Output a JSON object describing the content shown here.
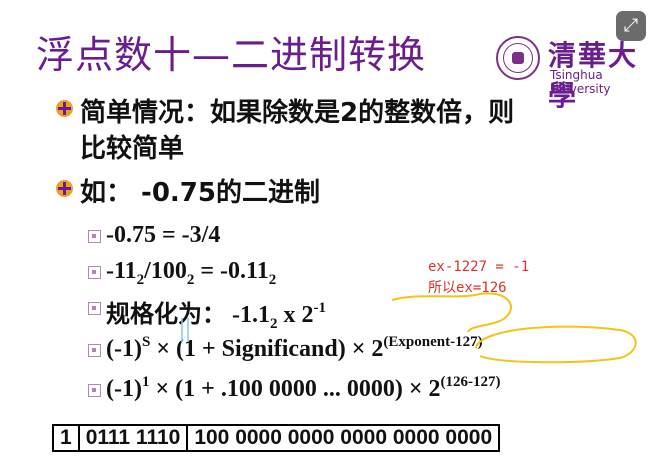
{
  "title": "浮点数十—二进制转换",
  "logo": {
    "chinese": "清華大學",
    "english": "Tsinghua University"
  },
  "expand_button_icon": "expand-arrows-icon",
  "bullets": [
    {
      "line1": "简单情况：如果除数是2的整数倍，则",
      "line2": "比较简单"
    },
    {
      "label": "如： -0.75的二进制"
    }
  ],
  "steps": {
    "s1": "-0.75 = -3/4",
    "s2": {
      "a": "-11",
      "a_sub": "2",
      "b": "/100",
      "b_sub": "2",
      "c": " = -0.11",
      "c_sub": "2"
    },
    "s3": {
      "prefix": "规格化为： -1.1",
      "sub": "2",
      "mid": " x 2",
      "sup": "-1"
    },
    "s4": {
      "a": "(-1)",
      "sup1": "S",
      "b": " × (1 + Significand) × 2",
      "sup2": "(Exponent-127)"
    },
    "s5": {
      "a": "(-1)",
      "sup1": "1",
      "b": " × (1 + .100 0000 ... 0000) × 2",
      "sup2": "(126-127)"
    }
  },
  "annotations": {
    "note1": "ex-1227 = -1",
    "note2": "所以ex=126"
  },
  "bit_fields": {
    "sign": "1",
    "exponent": "0111 1110",
    "mantissa": "100 0000 0000 0000 0000 0000"
  },
  "colors": {
    "title": "#6a1d8c",
    "bullet": "#e8a22a",
    "annotation": "#e0302a",
    "highlight": "#f0c419"
  }
}
